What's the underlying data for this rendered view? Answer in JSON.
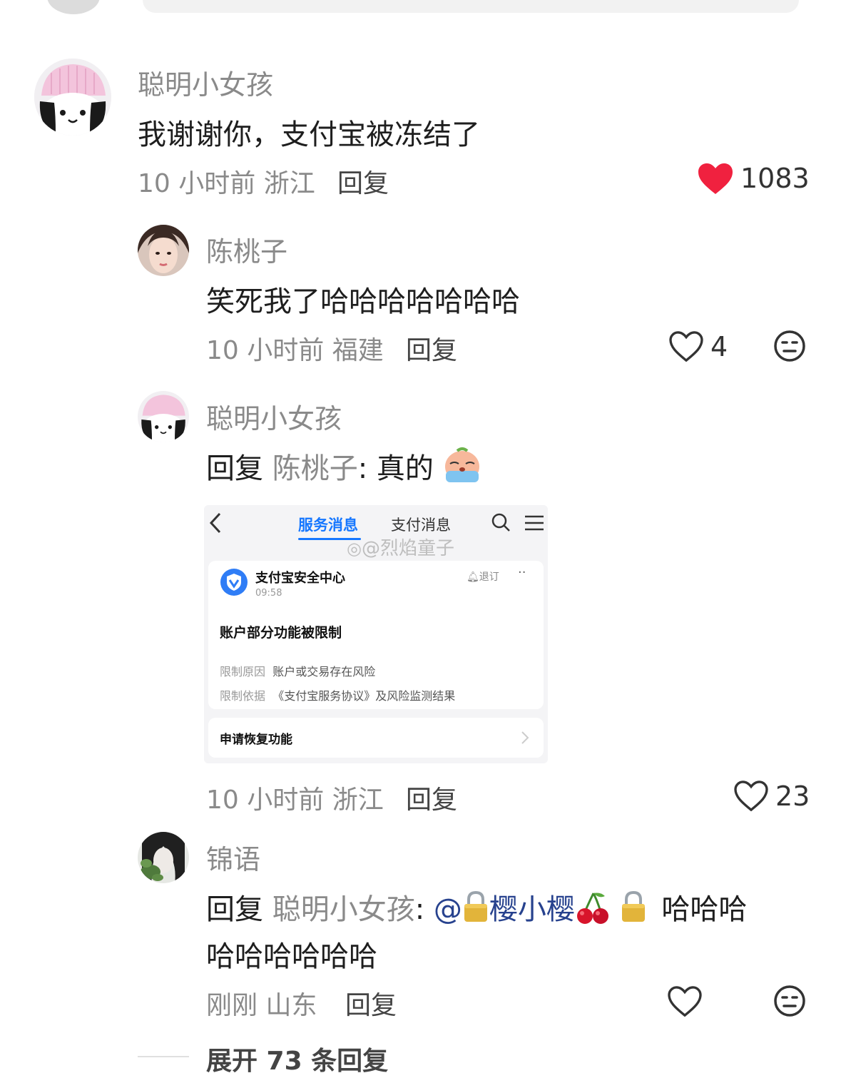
{
  "comments": [
    {
      "name": "聪明小女孩",
      "text": "我谢谢你，支付宝被冻结了",
      "time": "10 小时前",
      "location": "浙江",
      "reply_label": "回复",
      "likes": "1083",
      "liked": true
    },
    {
      "name": "陈桃子",
      "text": "笑死我了哈哈哈哈哈哈哈",
      "time": "10 小时前",
      "location": "福建",
      "reply_label": "回复",
      "likes": "4"
    },
    {
      "name": "聪明小女孩",
      "reply_prefix": "回复",
      "reply_to": "陈桃子",
      "text": "真的",
      "time": "10 小时前",
      "location": "浙江",
      "reply_label": "回复",
      "likes": "23",
      "attachment": {
        "tab_active": "服务消息",
        "tab_other": "支付消息",
        "watermark": "@烈焰童子",
        "sender": "支付宝安全中心",
        "send_time": "09:58",
        "unsubscribe": "退订",
        "headline": "账户部分功能被限制",
        "rows": [
          {
            "label": "限制原因",
            "value": "账户或交易存在风险"
          },
          {
            "label": "限制依据",
            "value": "《支付宝服务协议》及风险监测结果"
          }
        ],
        "action": "申请恢复功能"
      }
    },
    {
      "name": "锦语",
      "reply_prefix": "回复",
      "reply_to": "聪明小女孩",
      "mention": "@",
      "mention_name": "樱小樱",
      "text_tail": "哈哈哈",
      "text_line2": "哈哈哈哈哈哈",
      "time": "刚刚",
      "location": "山东",
      "reply_label": "回复"
    }
  ],
  "expand_label": "展开 73 条回复",
  "colors": {
    "like_red": "#f0213f",
    "name_gray": "#8a8a8a",
    "link_blue": "#27428e",
    "alipay_blue": "#1677ff"
  }
}
